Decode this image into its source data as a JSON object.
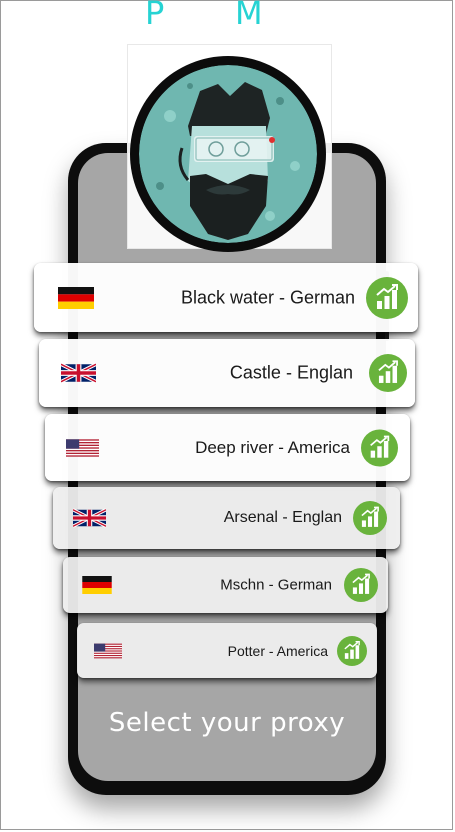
{
  "brand": {
    "left_letter": "P",
    "right_letter": "M",
    "color": "#26d3d3"
  },
  "proxies": [
    {
      "label": "Black water - German",
      "flag": "germany-flag-icon",
      "status_icon": "signal-strength-icon"
    },
    {
      "label": "Castle - Englan",
      "flag": "uk-flag-icon",
      "status_icon": "signal-strength-icon"
    },
    {
      "label": "Deep river - America",
      "flag": "usa-flag-icon",
      "status_icon": "signal-strength-icon"
    },
    {
      "label": "Arsenal - Englan",
      "flag": "uk-flag-icon",
      "status_icon": "signal-strength-icon"
    },
    {
      "label": "Mschn - German",
      "flag": "germany-flag-icon",
      "status_icon": "signal-strength-icon"
    },
    {
      "label": "Potter - America",
      "flag": "usa-flag-icon",
      "status_icon": "signal-strength-icon"
    }
  ],
  "footer": {
    "select_label": "Select your proxy"
  },
  "colors": {
    "accent_green": "#69b33c",
    "phone_screen": "#a6a6a6",
    "phone_body": "#0d0d0d"
  }
}
